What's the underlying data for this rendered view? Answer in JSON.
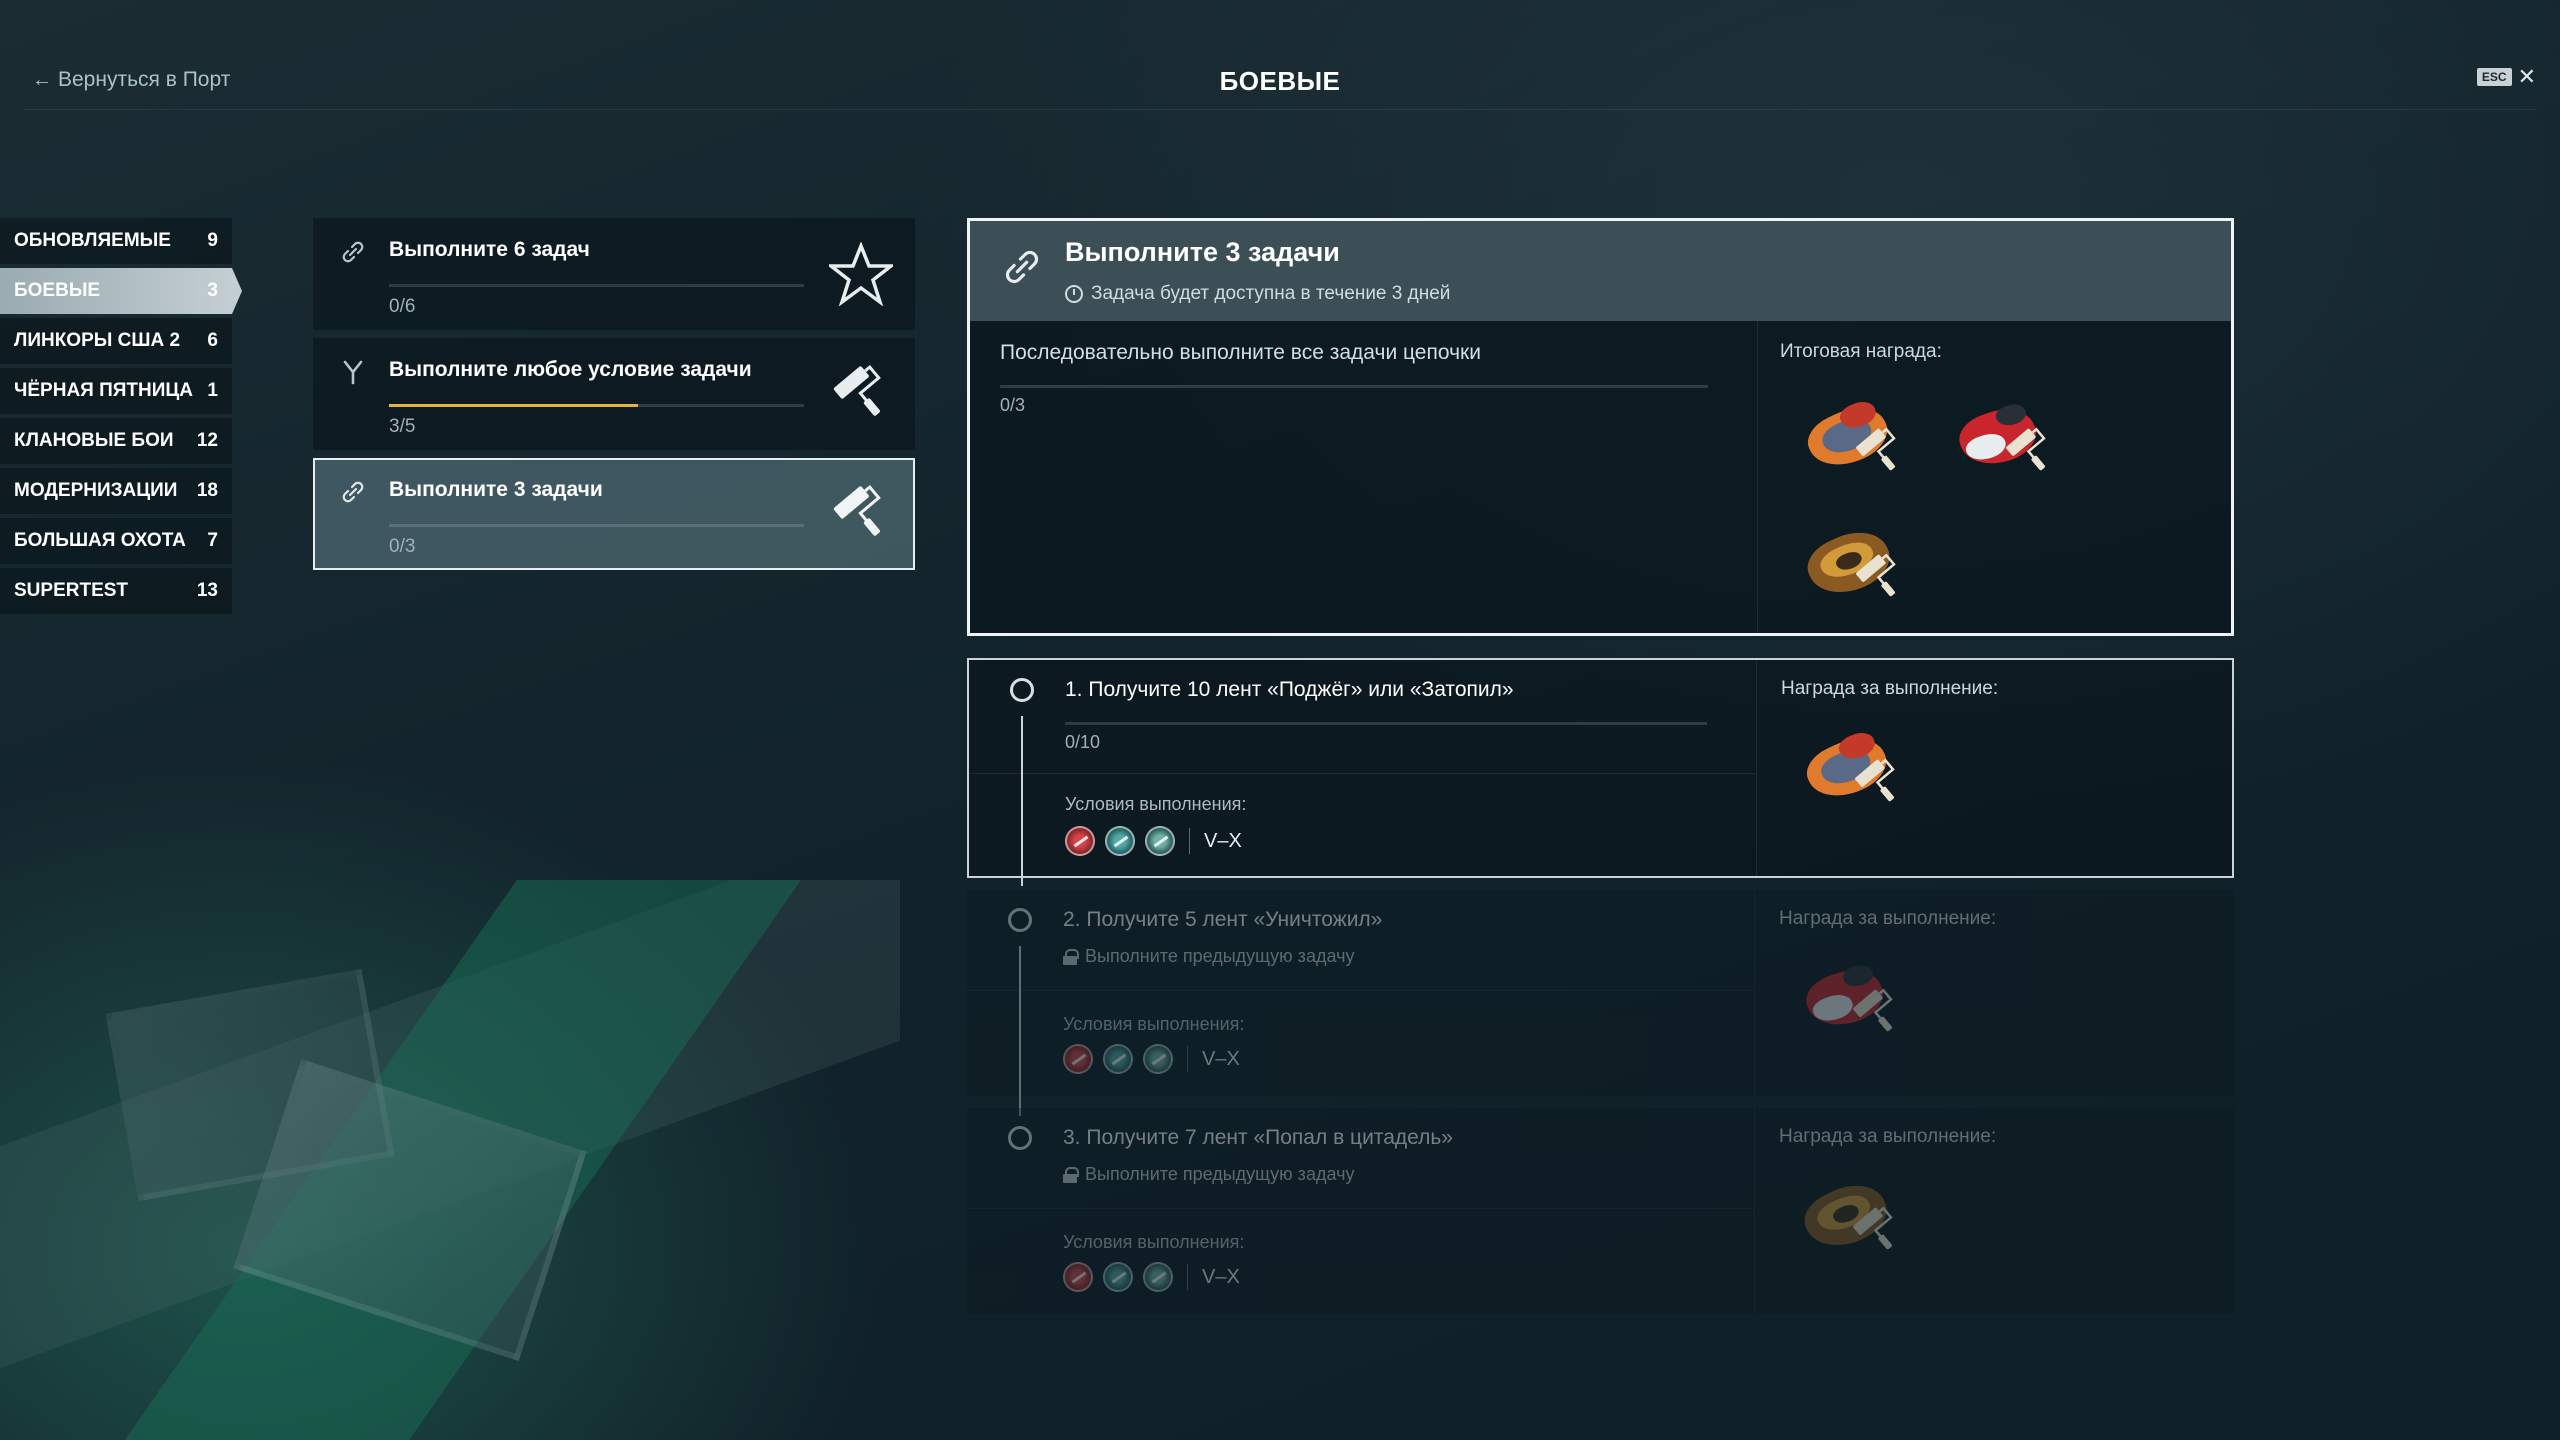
{
  "header": {
    "back_label": "Вернуться в Порт",
    "title": "БОЕВЫЕ",
    "esc_label": "ESC"
  },
  "sidebar": {
    "items": [
      {
        "label": "ОБНОВЛЯЕМЫЕ",
        "count": "9"
      },
      {
        "label": "БОЕВЫЕ",
        "count": "3",
        "active": true
      },
      {
        "label": "ЛИНКОРЫ США 2",
        "count": "6"
      },
      {
        "label": "ЧЁРНАЯ ПЯТНИЦА",
        "count": "1"
      },
      {
        "label": "КЛАНОВЫЕ БОИ",
        "count": "12"
      },
      {
        "label": "МОДЕРНИЗАЦИИ",
        "count": "18"
      },
      {
        "label": "БОЛЬШАЯ ОХОТА",
        "count": "7"
      },
      {
        "label": "SUPERTEST",
        "count": "13"
      }
    ]
  },
  "tasks": [
    {
      "title": "Выполните 6 задач",
      "progress_text": "0/6",
      "progress": 0.0,
      "reward_icon": "star-icon"
    },
    {
      "title": "Выполните любое условие задачи",
      "progress_text": "3/5",
      "progress": 0.6,
      "reward_icon": "camo-roller-icon"
    },
    {
      "title": "Выполните 3 задачи",
      "progress_text": "0/3",
      "progress": 0.0,
      "reward_icon": "camo-roller-icon",
      "active": true
    }
  ],
  "main": {
    "title": "Выполните 3 задачи",
    "subtitle": "Задача будет доступна в течение 3 дней",
    "description": "Последовательно выполните все задачи цепочки",
    "progress_text": "0/3",
    "reward_label": "Итоговая награда:"
  },
  "subtasks": [
    {
      "title": "1. Получите 10 лент «Поджёг» или «Затопил»",
      "progress_text": "0/10",
      "conditions_label": "Условия выполнения:",
      "tier": "V–X",
      "reward_label": "Награда за выполнение:"
    },
    {
      "title": "2. Получите 5 лент «Уничтожил»",
      "locked_text": "Выполните предыдущую задачу",
      "conditions_label": "Условия выполнения:",
      "tier": "V–X",
      "reward_label": "Награда за выполнение:"
    },
    {
      "title": "3. Получите 7 лент «Попал в цитадель»",
      "locked_text": "Выполните предыдущую задачу",
      "conditions_label": "Условия выполнения:",
      "tier": "V–X",
      "reward_label": "Награда за выполнение:"
    }
  ],
  "colors": {
    "accent_progress": "#e8b23c",
    "camo_orange": "#e07a2c",
    "camo_red": "#c8262c",
    "camo_brown": "#8a5a22"
  }
}
